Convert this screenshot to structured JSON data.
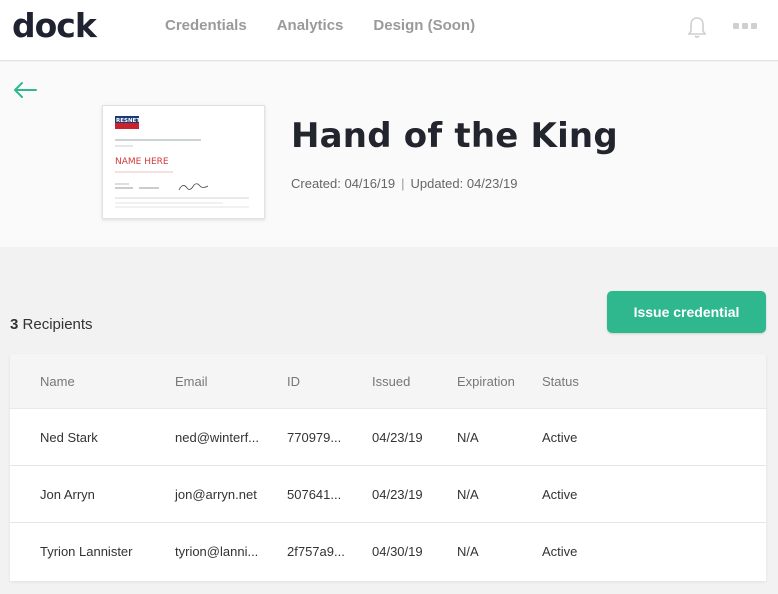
{
  "header": {
    "logo_text": "dock",
    "nav": [
      "Credentials",
      "Analytics",
      "Design (Soon)"
    ],
    "icons": {
      "notifications": "bell-icon",
      "more": "more-icon"
    }
  },
  "credential": {
    "title": "Hand of the King",
    "created": "Created: 04/16/19",
    "separator": "|",
    "updated": "Updated: 04/23/19",
    "thumbnail": {
      "brand": "RESNET",
      "name_placeholder": "NAME HERE"
    }
  },
  "recipients": {
    "count": "3",
    "label": "Recipients",
    "issue_button": "Issue credential",
    "columns": [
      "Name",
      "Email",
      "ID",
      "Issued",
      "Expiration",
      "Status"
    ],
    "rows": [
      {
        "name": "Ned Stark",
        "email": "ned@winterf...",
        "id": "770979...",
        "issued": "04/23/19",
        "expiration": "N/A",
        "status": "Active"
      },
      {
        "name": "Jon Arryn",
        "email": "jon@arryn.net",
        "id": "507641...",
        "issued": "04/23/19",
        "expiration": "N/A",
        "status": "Active"
      },
      {
        "name": "Tyrion Lannister",
        "email": "tyrion@lanni...",
        "id": "2f757a9...",
        "issued": "04/30/19",
        "expiration": "N/A",
        "status": "Active"
      }
    ]
  },
  "colors": {
    "accent": "#2fb88d",
    "title": "#22252e",
    "nav": "#9a9a9a"
  }
}
